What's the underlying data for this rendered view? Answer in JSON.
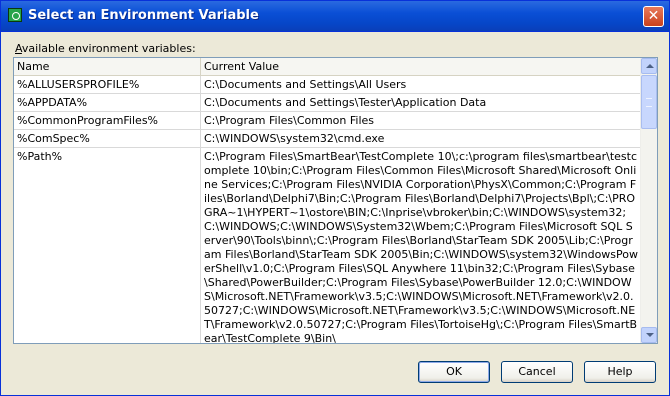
{
  "window": {
    "title": "Select an Environment Variable",
    "close_label": "✕"
  },
  "label": {
    "prefix": "A",
    "rest": "vailable environment variables:"
  },
  "columns": [
    "Name",
    "Current Value"
  ],
  "rows": [
    {
      "name": "%ALLUSERSPROFILE%",
      "value": "C:\\Documents and Settings\\All Users"
    },
    {
      "name": "%APPDATA%",
      "value": "C:\\Documents and Settings\\Tester\\Application Data"
    },
    {
      "name": "%CommonProgramFiles%",
      "value": "C:\\Program Files\\Common Files"
    },
    {
      "name": "%ComSpec%",
      "value": "C:\\WINDOWS\\system32\\cmd.exe"
    },
    {
      "name": "%Path%",
      "value": "C:\\Program Files\\SmartBear\\TestComplete 10\\;c:\\program files\\smartbear\\testcomplete 10\\bin;C:\\Program Files\\Common Files\\Microsoft Shared\\Microsoft Online Services;C:\\Program Files\\NVIDIA Corporation\\PhysX\\Common;C:\\Program Files\\Borland\\Delphi7\\Bin;C:\\Program Files\\Borland\\Delphi7\\Projects\\Bpl\\;C:\\PROGRA~1\\HYPERT~1\\ostore\\BIN;C:\\Inprise\\vbroker\\bin;C:\\WINDOWS\\system32;C:\\WINDOWS;C:\\WINDOWS\\System32\\Wbem;C:\\Program Files\\Microsoft SQL Server\\90\\Tools\\binn\\;C:\\Program Files\\Borland\\StarTeam SDK 2005\\Lib;C:\\Program Files\\Borland\\StarTeam SDK 2005\\Bin;C:\\WINDOWS\\system32\\WindowsPowerShell\\v1.0;C:\\Program Files\\SQL Anywhere 11\\bin32;C:\\Program Files\\Sybase\\Shared\\PowerBuilder;C:\\Program Files\\Sybase\\PowerBuilder 12.0;C:\\WINDOWS\\Microsoft.NET\\Framework\\v3.5;C:\\WINDOWS\\Microsoft.NET\\Framework\\v2.0.50727;C:\\WINDOWS\\Microsoft.NET\\Framework\\v3.5;C:\\WINDOWS\\Microsoft.NET\\Framework\\v2.0.50727;C:\\Program Files\\TortoiseHg\\;C:\\Program Files\\SmartBear\\TestComplete 9\\Bin\\"
    }
  ],
  "buttons": {
    "ok": "OK",
    "cancel": "Cancel",
    "help": "Help"
  },
  "colors": {
    "titlebar": "#0a4fd6",
    "face": "#ece9d8",
    "button_border": "#003c74"
  }
}
